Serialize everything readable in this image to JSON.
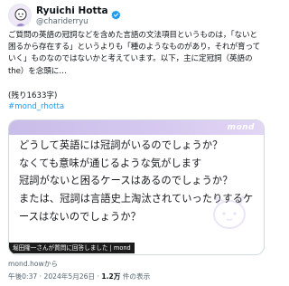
{
  "colors": {
    "link": "#1d9bf0",
    "verified": "#1d9bf0",
    "card_accent": "#c9bde9",
    "caption_bg": "#1b1b1b"
  },
  "author": {
    "display_name": "Ryuichi Hotta",
    "handle": "@chariderryu",
    "verified_icon": "verified-badge-icon"
  },
  "tweet": {
    "text": "ご質問の英語の冠詞などを含めた言語の文法項目というものは，「ないと困るから存在する」というよりも「種のようなものがあり，それが育っていく」ものなのではないかと考えています。以下，主に定冠詞（英語のthe）を念頭に…",
    "remaining": "(残り1633字)",
    "hashtag": "#mond_rhotta"
  },
  "card": {
    "brand": "mond",
    "question": "どうして英語には冠詞がいるのでしょうか？\nなくても意味が通じるような気がします\n冠詞がないと困るケースはあるのでしょうか？\nまたは、冠詞は言語史上淘汰されていったりするケースはないのでしょうか？",
    "caption": "堀田隆一さんが質問に回答しました | mond"
  },
  "source": "mond.howから",
  "meta": {
    "time_date": "午後0:37 · 2024年5月26日 · ",
    "views_count": "1.2万",
    "views_suffix": " 件の表示"
  }
}
